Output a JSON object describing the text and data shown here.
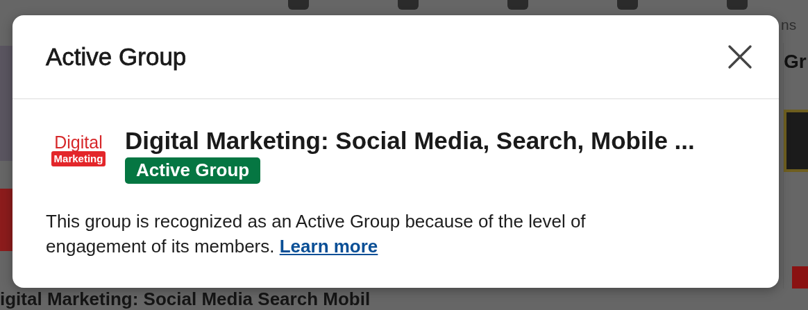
{
  "background": {
    "nav_label": "ns",
    "side_heading": "Gr",
    "feed_title": "igital Marketing: Social Media Search Mobil"
  },
  "modal": {
    "title": "Active Group",
    "group": {
      "logo_top": "Digital",
      "logo_bottom": "Marketing",
      "name": "Digital Marketing: Social Media, Search, Mobile ...",
      "badge": "Active Group"
    },
    "description": "This group is recognized as an Active Group because of the level of engagement of its members.",
    "link": "Learn more"
  }
}
